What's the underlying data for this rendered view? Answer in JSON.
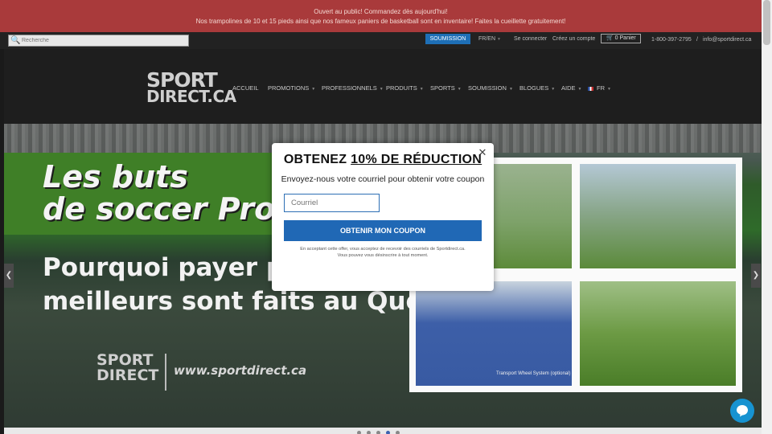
{
  "announcement": {
    "line1": "Ouvert au public! Commandez dès aujourd'hui!",
    "line2": "Nos trampolines de 10 et 15 pieds ainsi que nos fameux paniers de basketball sont en inventaire! Faites la cueillette gratuitement!"
  },
  "topbar": {
    "search_placeholder": "Recherche",
    "soumission": "SOUMISSION",
    "lang": "FR/EN",
    "login": "Se connecter",
    "create_account": "Créez un compte",
    "cart": "0 Panier",
    "phone": "1-800-397-2795",
    "sep": "/",
    "email": "info@sportdirect.ca"
  },
  "logo": {
    "line1": "SPORT",
    "line2": "DIRECT.CA"
  },
  "nav": [
    {
      "label": "ACCUEIL"
    },
    {
      "label": "PROMOTIONS"
    },
    {
      "label": "PROFESSIONNELS"
    },
    {
      "label": "PRODUITS"
    },
    {
      "label": "SPORTS"
    },
    {
      "label": "SOUMISSION"
    },
    {
      "label": "BLOGUES"
    },
    {
      "label": "AIDE"
    },
    {
      "label": "FR"
    }
  ],
  "hero": {
    "headline1": "Les buts",
    "headline2": "de soccer Pro",
    "sub1": "Pourquoi payer plus",
    "sub2": "meilleurs sont faits au Québec",
    "brand1": "SPORT",
    "brand2": "DIRECT",
    "url": "www.sportdirect.ca",
    "caption": "Transport Wheel System (optional)"
  },
  "modal": {
    "title_prefix": "OBTENEZ ",
    "title_emph": "10% DE RÉDUCTION",
    "subtitle": "Envoyez-nous votre courriel pour obtenir votre coupon",
    "email_placeholder": "Courriel",
    "cta": "OBTENIR MON COUPON",
    "fine1": "En acceptant cette offer, vous acceptez de recevoir des courriels de Sportdirect.ca.",
    "fine2": "Vous pouvez vous désinscrire à tout moment."
  },
  "colors": {
    "announcement": "#a93a3b",
    "accent": "#2068b5",
    "chat": "#1793d1"
  }
}
